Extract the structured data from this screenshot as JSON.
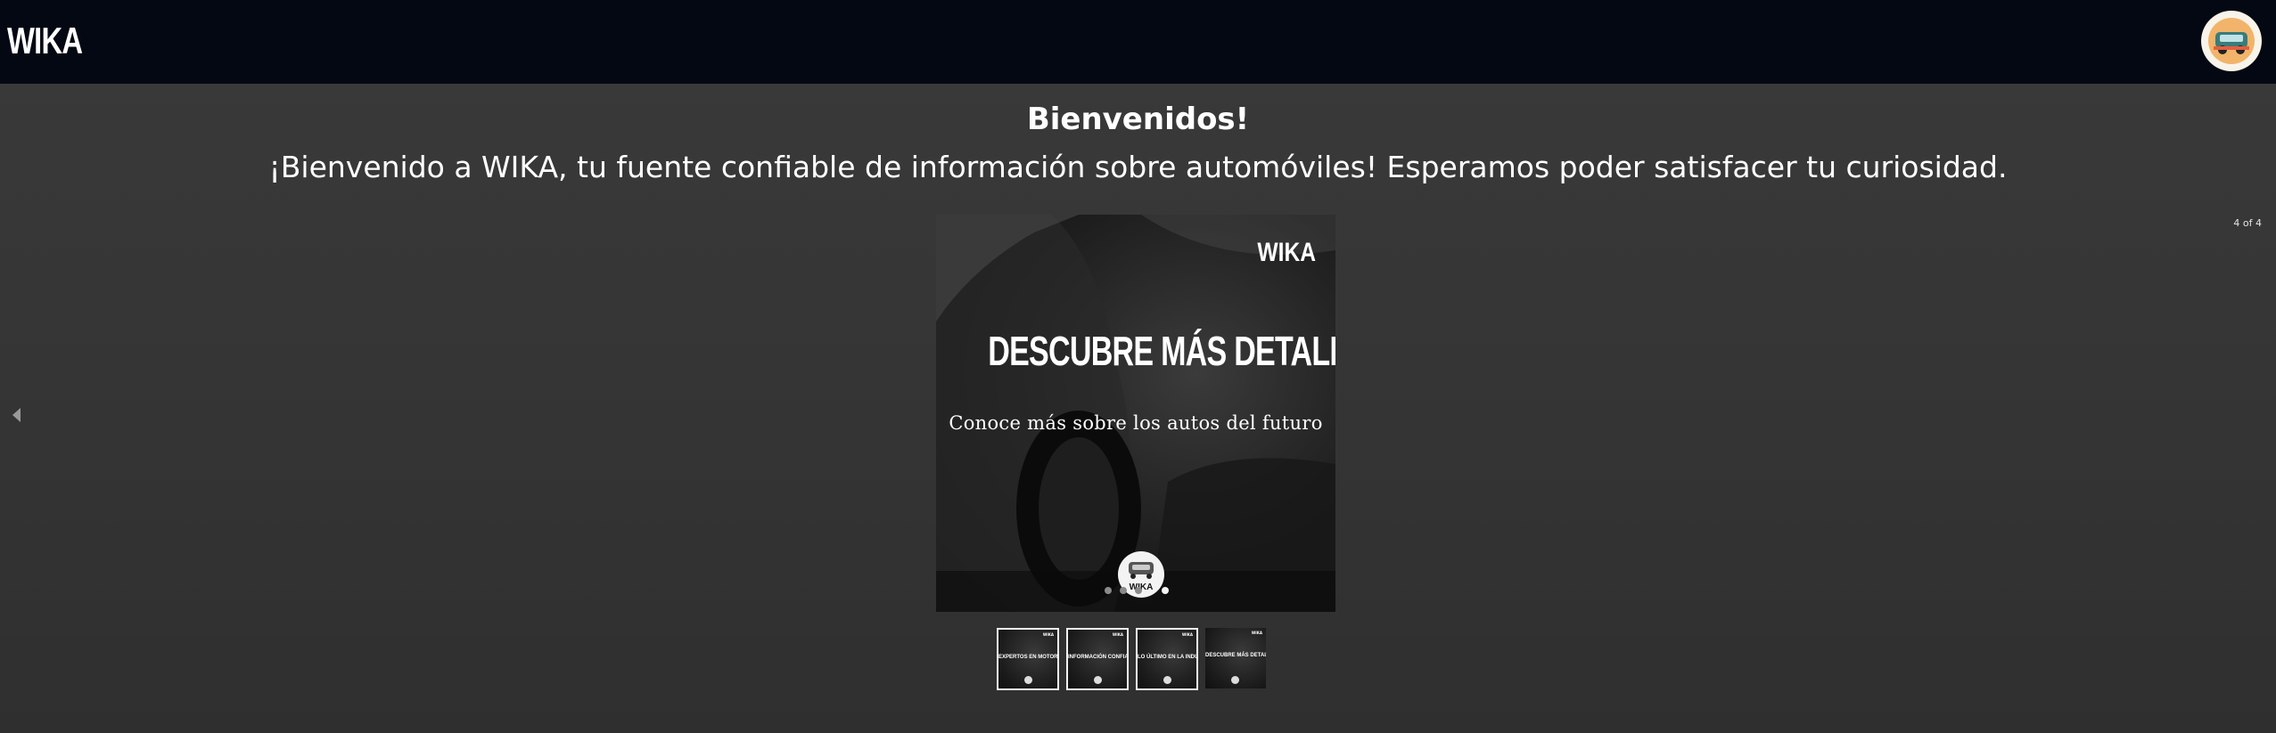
{
  "header": {
    "brand": "WIKA",
    "avatar_icon": "wika-logo-icon"
  },
  "welcome": {
    "title": "Bienvenidos!",
    "subtitle": "¡Bienvenido a WIKA, tu fuente confiable de información sobre automóviles! Esperamos poder satisfacer tu curiosidad."
  },
  "carousel": {
    "counter": "4 of 4",
    "active_index": 4,
    "slide": {
      "brand": "WIKA",
      "title": "DESCUBRE MÁS DETALLES",
      "subtitle": "Conoce más sobre los autos del futuro",
      "logo_text": "WIKA"
    },
    "thumbnails": [
      {
        "label": "EXPERTOS EN MOTOR"
      },
      {
        "label": "INFORMACIÓN CONFIABLE"
      },
      {
        "label": "LO ÚLTIMO EN LA INDUSTRIA"
      },
      {
        "label": "DESCUBRE MÁS DETALLES"
      }
    ]
  }
}
